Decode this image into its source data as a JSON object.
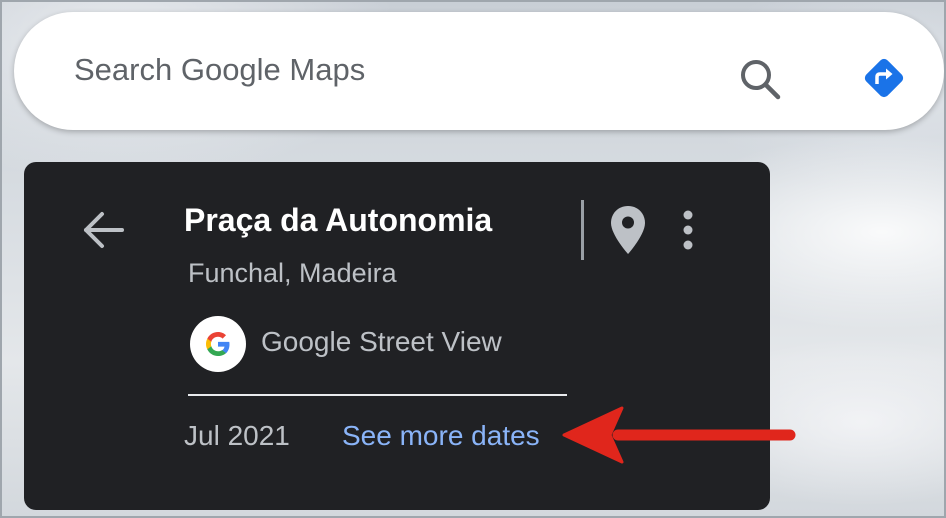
{
  "search": {
    "placeholder": "Search Google Maps",
    "search_icon": "search-icon",
    "directions_icon": "directions-icon"
  },
  "place_card": {
    "title": "Praça da Autonomia",
    "subtitle": "Funchal, Madeira",
    "source": "Google Street View",
    "capture_date": "Jul 2021",
    "more_dates_link": "See more dates",
    "icons": {
      "back": "arrow-back-icon",
      "pin": "map-pin-icon",
      "more": "more-vert-icon",
      "logo": "google-g-logo"
    }
  },
  "colors": {
    "card_background": "#202124",
    "title_text": "#ffffff",
    "secondary_text": "#bdc1c6",
    "link": "#8ab4f8",
    "directions_blue": "#1a73e8",
    "annotation_arrow": "#e0261c"
  }
}
